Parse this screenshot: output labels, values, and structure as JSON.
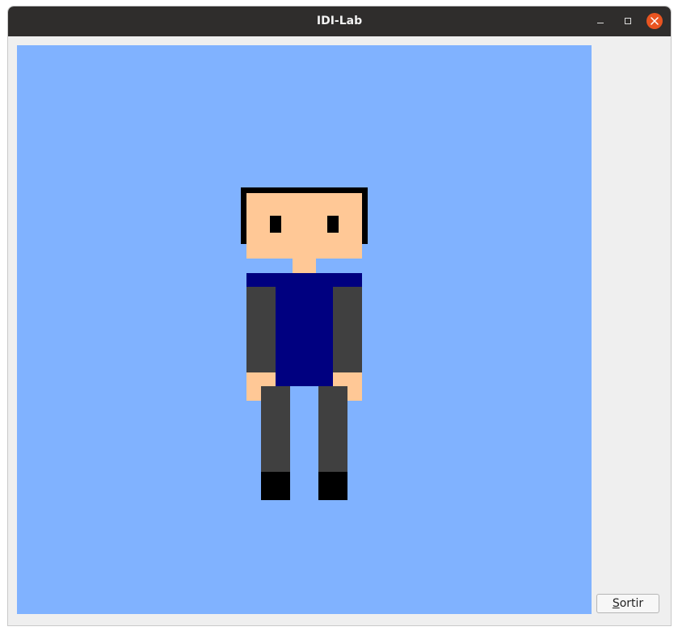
{
  "window": {
    "title": "IDI-Lab",
    "controls": {
      "minimize": "minimize-icon",
      "maximize": "maximize-icon",
      "close": "close-icon"
    }
  },
  "scene": {
    "background_color": "#80b2ff",
    "character_colors": {
      "hair": "#000000",
      "skin": "#ffc896",
      "shirt": "#000080",
      "shirt_collar": "#000080",
      "sleeves": "#404040",
      "trousers": "#404040",
      "shoes": "#000000",
      "eyes": "#000000"
    }
  },
  "buttons": {
    "exit": {
      "mnemonic": "S",
      "rest": "ortir"
    }
  }
}
